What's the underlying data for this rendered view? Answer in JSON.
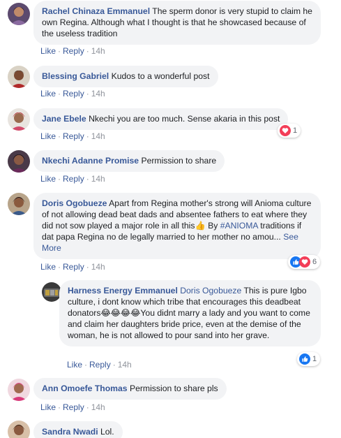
{
  "comments": [
    {
      "author": "Rachel Chinaza Emmanuel",
      "text": "The sperm donor is very stupid to claim he own Regina. Although what I thought is that he showcased because of the useless tradition",
      "like": "Like",
      "reply": "Reply",
      "time": "14h"
    },
    {
      "author": "Blessing Gabriel",
      "text": "Kudos to a wonderful post",
      "like": "Like",
      "reply": "Reply",
      "time": "14h"
    },
    {
      "author": "Jane Ebele",
      "text": "Nkechi you are too much. Sense akaria in this post",
      "like": "Like",
      "reply": "Reply",
      "time": "14h",
      "reactions": {
        "count": "1",
        "icon": "love-icon"
      }
    },
    {
      "author": "Nkechi Adanne Promise",
      "text": "Permission to share",
      "like": "Like",
      "reply": "Reply",
      "time": "14h"
    },
    {
      "author": "Doris Ogobueze",
      "text_a": "Apart from Regina mother's strong will Anioma culture of not allowing dead beat dads and absentee fathers to eat where they did not sow played a major role in all this",
      "emoji": "👍",
      "text_b": " By ",
      "hashtag": "#ANIOMA",
      "text_c": " traditions if dat papa Regina no de legally married to her mother no amou...",
      "see_more": "See More",
      "like": "Like",
      "reply": "Reply",
      "time": "14h",
      "reactions": {
        "count": "6",
        "icons": [
          "like-icon",
          "love-icon"
        ]
      }
    },
    {
      "author": "Ann Omoefe Thomas",
      "text": "Permission to share pls",
      "like": "Like",
      "reply": "Reply",
      "time": "14h"
    },
    {
      "author": "Sandra Nwadi",
      "text": "Lol."
    }
  ],
  "reply_comment": {
    "author": "Harness Energy Emmanuel",
    "tagged": "Doris Ogobueze",
    "text_a": " This is pure Igbo culture, i dont know which tribe that encourages this deadbeat donators",
    "emojis": "😂😂😂😂",
    "text_b": "You didnt marry a lady and you want to come and claim her daughters bride price, even at the demise of the woman, he is not allowed to pour sand into her grave.",
    "like": "Like",
    "reply": "Reply",
    "time": "14h",
    "reactions": {
      "count": "1",
      "icon": "like-icon"
    }
  },
  "colors": {
    "link": "#385898",
    "bubble": "#f2f3f5",
    "like_blue": "#1877f2",
    "love_red": "#f33e58"
  }
}
